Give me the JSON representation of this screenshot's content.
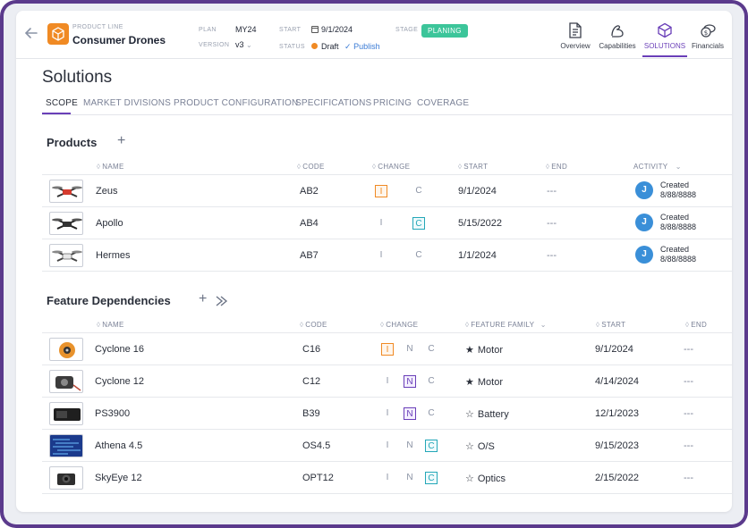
{
  "header": {
    "product_line_label": "PRODUCT LINE",
    "product_line_name": "Consumer Drones",
    "plan_label": "PLAN",
    "plan_value": "MY24",
    "version_label": "VERSION",
    "version_value": "v3",
    "start_label": "START",
    "start_value": "9/1/2024",
    "status_label": "STATUS",
    "status_value": "Draft",
    "publish_label": "Publish",
    "stage_label": "STAGE",
    "stage_value": "PLANING",
    "stage_color": "#3cc59a",
    "brand_color": "#f08a24",
    "accent_color": "#6a3fb8"
  },
  "nav": [
    {
      "label": "Overview",
      "icon": "document-icon"
    },
    {
      "label": "Capabilities",
      "icon": "arm-icon"
    },
    {
      "label": "SOLUTIONS",
      "icon": "cube-icon"
    },
    {
      "label": "Financials",
      "icon": "money-icon"
    }
  ],
  "page": {
    "title": "Solutions",
    "tabs": [
      "SCOPE",
      "MARKET DIVISIONS",
      "PRODUCT CONFIGURATION",
      "SPECIFICATIONS",
      "PRICING",
      "COVERAGE"
    ]
  },
  "products": {
    "title": "Products",
    "columns": {
      "name": "NAME",
      "code": "CODE",
      "change": "CHANGE",
      "start": "START",
      "end": "END",
      "activity": "ACTIVITY"
    },
    "rows": [
      {
        "name": "Zeus",
        "code": "AB2",
        "change_i": "I",
        "change_c": "C",
        "active": "I",
        "start": "9/1/2024",
        "end": "---",
        "avatar": "J",
        "activity_line1": "Created",
        "activity_line2": "8/88/8888"
      },
      {
        "name": "Apollo",
        "code": "AB4",
        "change_i": "I",
        "change_c": "C",
        "active": "C",
        "start": "5/15/2022",
        "end": "---",
        "avatar": "J",
        "activity_line1": "Created",
        "activity_line2": "8/88/8888"
      },
      {
        "name": "Hermes",
        "code": "AB7",
        "change_i": "I",
        "change_c": "C",
        "active": "",
        "start": "1/1/2024",
        "end": "---",
        "avatar": "J",
        "activity_line1": "Created",
        "activity_line2": "8/88/8888"
      }
    ]
  },
  "features": {
    "title": "Feature Dependencies",
    "columns": {
      "name": "NAME",
      "code": "CODE",
      "change": "CHANGE",
      "family": "FEATURE FAMILY",
      "start": "START",
      "end": "END"
    },
    "rows": [
      {
        "name": "Cyclone 16",
        "code": "C16",
        "i": "I",
        "n": "N",
        "c": "C",
        "active": "I",
        "star": "★",
        "family": "Motor",
        "start": "9/1/2024",
        "end": "---"
      },
      {
        "name": "Cyclone 12",
        "code": "C12",
        "i": "I",
        "n": "N",
        "c": "C",
        "active": "N",
        "star": "★",
        "family": "Motor",
        "start": "4/14/2024",
        "end": "---"
      },
      {
        "name": "PS3900",
        "code": "B39",
        "i": "I",
        "n": "N",
        "c": "C",
        "active": "N",
        "star": "☆",
        "family": "Battery",
        "start": "12/1/2023",
        "end": "---"
      },
      {
        "name": "Athena 4.5",
        "code": "OS4.5",
        "i": "I",
        "n": "N",
        "c": "C",
        "active": "C",
        "star": "☆",
        "family": "O/S",
        "start": "9/15/2023",
        "end": "---"
      },
      {
        "name": "SkyEye 12",
        "code": "OPT12",
        "i": "I",
        "n": "N",
        "c": "C",
        "active": "C",
        "star": "☆",
        "family": "Optics",
        "start": "2/15/2022",
        "end": "---"
      }
    ]
  }
}
